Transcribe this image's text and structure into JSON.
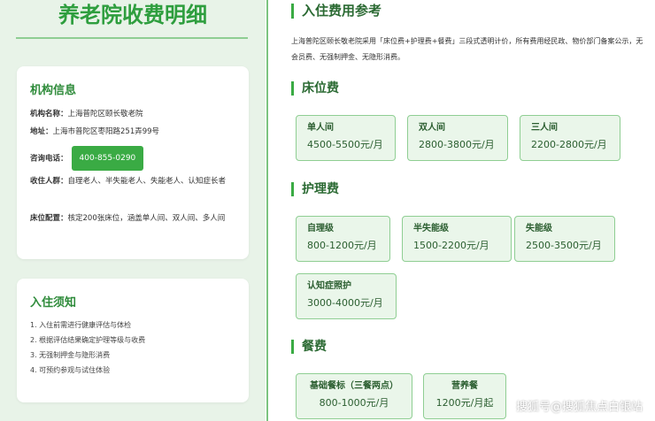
{
  "left": {
    "title": "养老院收费明细",
    "info_card": {
      "title": "机构信息",
      "name_label": "机构名称：",
      "name_value": "上海普陀区颐长敬老院",
      "address_label": "地址：",
      "address_value": "上海市普陀区枣阳路251弄99号",
      "phone_label": "咨询电话：",
      "phone_value": "400-855-0290",
      "audience_label": "收住人群：",
      "audience_value": "自理老人、半失能老人、失能老人、认知症长者",
      "beds_label": "床位配置：",
      "beds_value": "核定200张床位，涵盖单人间、双人间、多人间"
    },
    "notice_card": {
      "title": "入住须知",
      "items": [
        "1. 入住前需进行健康评估与体检",
        "2. 根据评估结果确定护理等级与收费",
        "3. 无强制押金与隐形消费",
        "4. 可预约参观与试住体验"
      ]
    }
  },
  "right": {
    "main_title": "入住费用参考",
    "intro": "上海普陀区颐长敬老院采用「床位费+护理费+餐费」三段式透明计价，所有费用经民政、物价部门备案公示，无会员费、无强制押金、无隐形消费。",
    "bed": {
      "title": "床位费",
      "items": [
        {
          "name": "单人间",
          "price": "4500-5500元/月"
        },
        {
          "name": "双人间",
          "price": "2800-3800元/月"
        },
        {
          "name": "三人间",
          "price": "2200-2800元/月"
        }
      ]
    },
    "care": {
      "title": "护理费",
      "items": [
        {
          "name": "自理级",
          "price": "800-1200元/月"
        },
        {
          "name": "半失能级",
          "price": "1500-2200元/月"
        },
        {
          "name": "失能级",
          "price": "2500-3500元/月"
        },
        {
          "name": "认知症照护",
          "price": "3000-4000元/月"
        }
      ]
    },
    "meal": {
      "title": "餐费",
      "items": [
        {
          "name": "基础餐标（三餐两点）",
          "price": "800-1000元/月"
        },
        {
          "name": "营养餐",
          "price": "1200元/月起"
        }
      ]
    }
  },
  "watermark": "搜狐号@搜狐焦点白银站",
  "colors": {
    "accent": "#3aab44",
    "title_green": "#2e9e3e",
    "left_bg": "#e8f3e8",
    "fee_bg": "#eaf6ea",
    "fee_border": "#8fce93"
  }
}
